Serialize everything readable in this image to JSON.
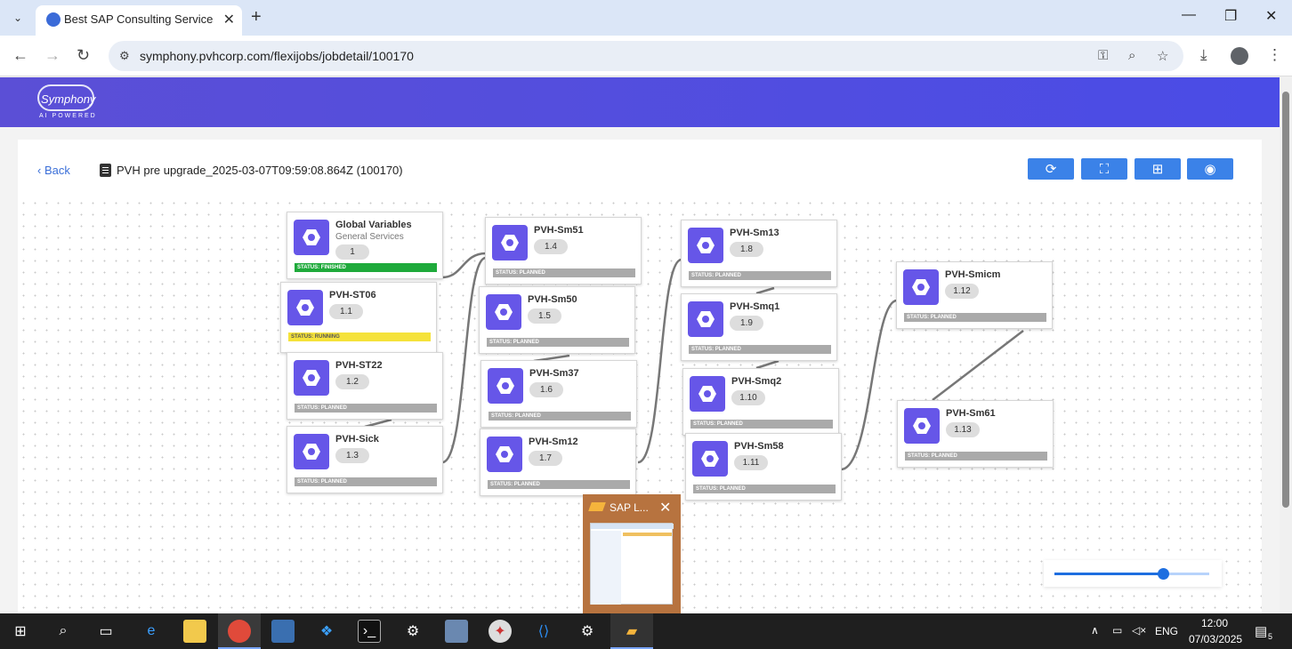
{
  "browser": {
    "tab_title": "Best SAP Consulting Services ar",
    "url": "symphony.pvhcorp.com/flexijobs/jobdetail/100170",
    "new_tab_symbol": "+",
    "close_symbol": "✕",
    "minimize": "—",
    "restore": "❐",
    "close_window": "✕"
  },
  "app": {
    "logo_name": "Symphony",
    "logo_sub": "AI POWERED",
    "back_label": "Back",
    "job_title": "PVH pre upgrade_2025-03-07T09:59:08.864Z (100170)"
  },
  "toolbar": {
    "refresh_icon": "⟳",
    "fullscreen_icon": "⛶",
    "add_icon": "⊞",
    "view_icon": "◉"
  },
  "nodes": [
    {
      "name": "Global Variables",
      "sub": "General Services",
      "num": "1",
      "status": "STATUS: FINISHED"
    },
    {
      "name": "PVH-ST06",
      "num": "1.1",
      "status": "STATUS: RUNNING"
    },
    {
      "name": "PVH-ST22",
      "num": "1.2",
      "status": "STATUS: PLANNED"
    },
    {
      "name": "PVH-Sick",
      "num": "1.3",
      "status": "STATUS: PLANNED"
    },
    {
      "name": "PVH-Sm51",
      "num": "1.4",
      "status": "STATUS: PLANNED"
    },
    {
      "name": "PVH-Sm50",
      "num": "1.5",
      "status": "STATUS: PLANNED"
    },
    {
      "name": "PVH-Sm37",
      "num": "1.6",
      "status": "STATUS: PLANNED"
    },
    {
      "name": "PVH-Sm12",
      "num": "1.7",
      "status": "STATUS: PLANNED"
    },
    {
      "name": "PVH-Sm13",
      "num": "1.8",
      "status": "STATUS: PLANNED"
    },
    {
      "name": "PVH-Smq1",
      "num": "1.9",
      "status": "STATUS: PLANNED"
    },
    {
      "name": "PVH-Smq2",
      "num": "1.10",
      "status": "STATUS: PLANNED"
    },
    {
      "name": "PVH-Sm58",
      "num": "1.11",
      "status": "STATUS: PLANNED"
    },
    {
      "name": "PVH-Smicm",
      "num": "1.12",
      "status": "STATUS: PLANNED"
    },
    {
      "name": "PVH-Sm61",
      "num": "1.13",
      "status": "STATUS: PLANNED"
    }
  ],
  "zoom_slider": {
    "value": 0.7
  },
  "popup": {
    "title": "SAP L..."
  },
  "taskbar": {
    "lang": "ENG",
    "time": "12:00",
    "date": "07/03/2025",
    "notifications": "5"
  },
  "colors": {
    "accent": "#5b4fd6",
    "button": "#3b82e8",
    "finished": "#1faa3b",
    "running": "#f5e23a",
    "planned": "#aaaaaa"
  }
}
